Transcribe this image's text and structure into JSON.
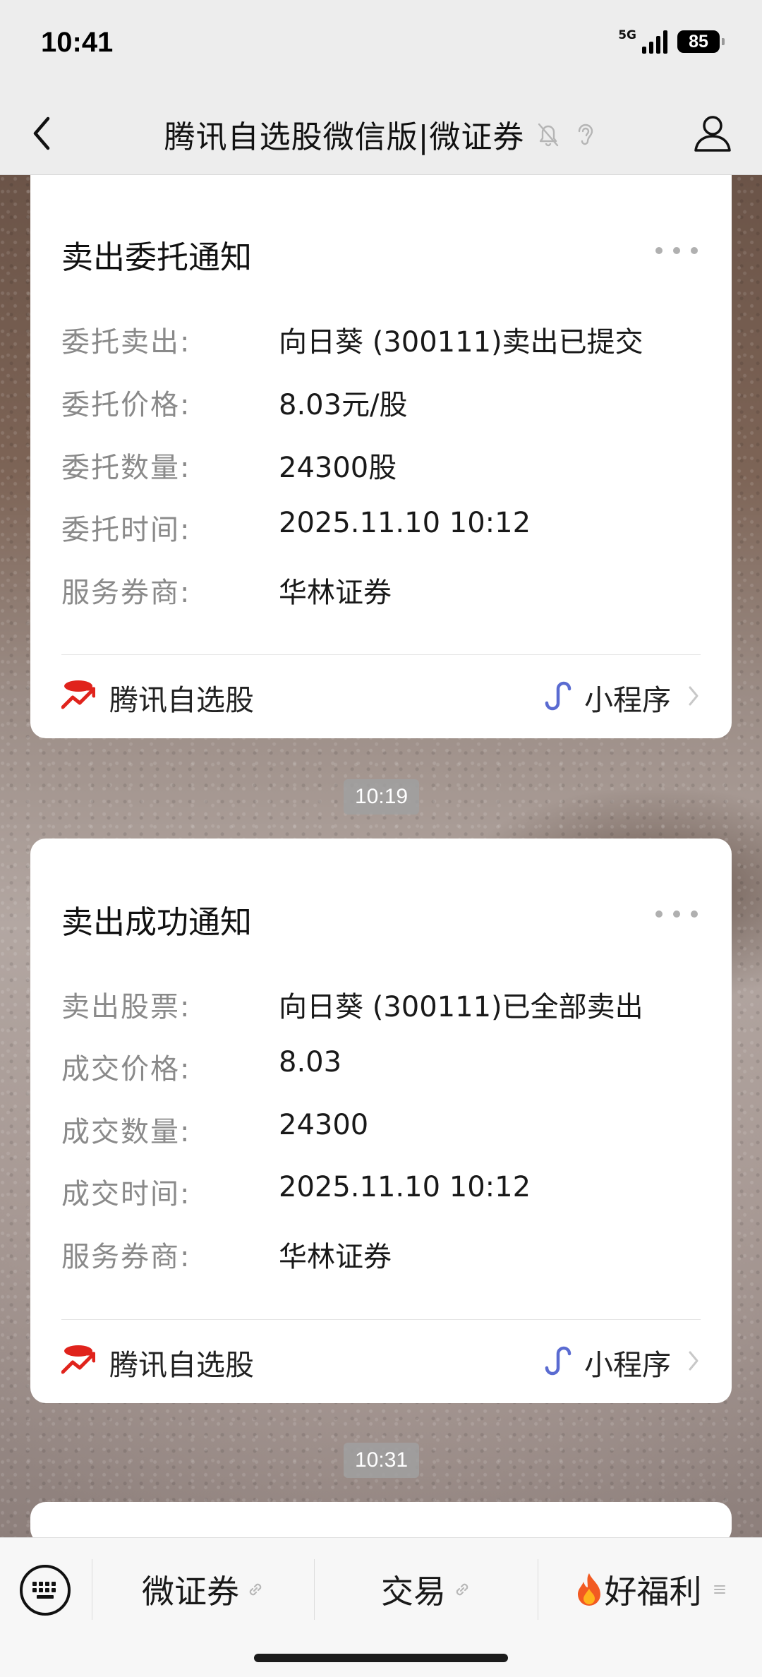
{
  "status_bar": {
    "time": "10:41",
    "network": "5G",
    "battery": "85"
  },
  "nav": {
    "title": "腾讯自选股微信版|微证券"
  },
  "cards": [
    {
      "title": "卖出委托通知",
      "rows": [
        {
          "label": "委托卖出:",
          "value": "向日葵 (300111)卖出已提交"
        },
        {
          "label": "委托价格:",
          "value": "8.03元/股"
        },
        {
          "label": "委托数量:",
          "value": "24300股"
        },
        {
          "label": "委托时间:",
          "value": "2025.11.10 10:12"
        },
        {
          "label": "服务券商:",
          "value": "华林证券"
        }
      ],
      "footer": {
        "brand": "腾讯自选股",
        "mini_program": "小程序"
      }
    },
    {
      "title": "卖出成功通知",
      "rows": [
        {
          "label": "卖出股票:",
          "value": "向日葵 (300111)已全部卖出"
        },
        {
          "label": "成交价格:",
          "value": "8.03"
        },
        {
          "label": "成交数量:",
          "value": "24300"
        },
        {
          "label": "成交时间:",
          "value": "2025.11.10 10:12"
        },
        {
          "label": "服务券商:",
          "value": "华林证券"
        }
      ],
      "footer": {
        "brand": "腾讯自选股",
        "mini_program": "小程序"
      }
    }
  ],
  "timestamps": [
    "10:19",
    "10:31"
  ],
  "bottom_menu": {
    "items": [
      {
        "label": "微证券",
        "icon": "link-icon"
      },
      {
        "label": "交易",
        "icon": "link-icon"
      },
      {
        "label": "好福利",
        "icon": "fire-icon"
      }
    ]
  },
  "colors": {
    "brand_red": "#e0231c",
    "mini_program_blue": "#5a6bd1",
    "label_gray": "#8a8a8a"
  }
}
